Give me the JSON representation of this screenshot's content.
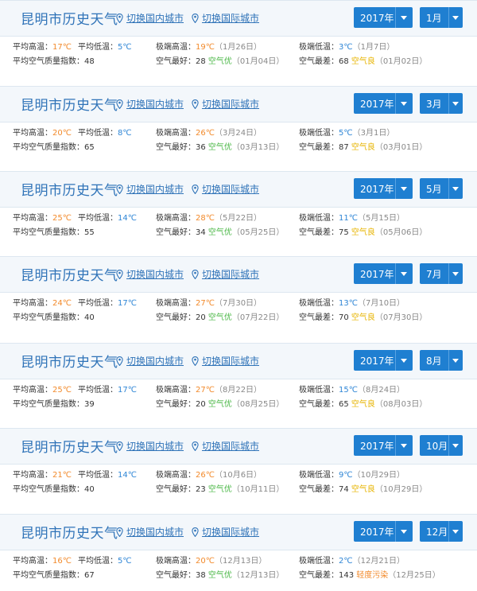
{
  "colors": {
    "accent": "#2f73b8",
    "dropdown": "#1f7fd1",
    "high_temp": "#f28a2b",
    "low_temp": "#2f86d6",
    "air_good": "#4cb848",
    "air_fair": "#e7b400",
    "air_polluted": "#f28a2b"
  },
  "icons": {
    "location": "map-pin-icon",
    "dropdown": "caret-down-icon"
  },
  "common": {
    "city_title": "昆明市历史天气",
    "link_domestic": "切换国内城市",
    "link_international": "切换国际城市",
    "label_avg_high": "平均高温：",
    "label_avg_low": "平均低温：",
    "label_ext_high": "极端高温：",
    "label_ext_low": "极端低温：",
    "label_avg_aqi": "平均空气质量指数：",
    "label_air_best": "空气最好：",
    "label_air_worst": "空气最差："
  },
  "panels": [
    {
      "year": "2017年",
      "month": "1月",
      "avg_high": "17℃",
      "avg_low": "5℃",
      "ext_high": "19℃",
      "ext_high_date": "（1月26日）",
      "ext_low": "3℃",
      "ext_low_date": "（1月7日）",
      "avg_aqi": "48",
      "best_value": "28",
      "best_level": "空气优",
      "best_date": "（01月04日）",
      "worst_value": "68",
      "worst_level": "空气良",
      "worst_date": "（01月02日）"
    },
    {
      "year": "2017年",
      "month": "3月",
      "avg_high": "20℃",
      "avg_low": "8℃",
      "ext_high": "26℃",
      "ext_high_date": "（3月24日）",
      "ext_low": "5℃",
      "ext_low_date": "（3月1日）",
      "avg_aqi": "65",
      "best_value": "36",
      "best_level": "空气优",
      "best_date": "（03月13日）",
      "worst_value": "87",
      "worst_level": "空气良",
      "worst_date": "（03月01日）"
    },
    {
      "year": "2017年",
      "month": "5月",
      "avg_high": "25℃",
      "avg_low": "14℃",
      "ext_high": "28℃",
      "ext_high_date": "（5月22日）",
      "ext_low": "11℃",
      "ext_low_date": "（5月15日）",
      "avg_aqi": "55",
      "best_value": "34",
      "best_level": "空气优",
      "best_date": "（05月25日）",
      "worst_value": "75",
      "worst_level": "空气良",
      "worst_date": "（05月06日）"
    },
    {
      "year": "2017年",
      "month": "7月",
      "avg_high": "24℃",
      "avg_low": "17℃",
      "ext_high": "27℃",
      "ext_high_date": "（7月30日）",
      "ext_low": "13℃",
      "ext_low_date": "（7月10日）",
      "avg_aqi": "40",
      "best_value": "20",
      "best_level": "空气优",
      "best_date": "（07月22日）",
      "worst_value": "70",
      "worst_level": "空气良",
      "worst_date": "（07月30日）"
    },
    {
      "year": "2017年",
      "month": "8月",
      "avg_high": "25℃",
      "avg_low": "17℃",
      "ext_high": "27℃",
      "ext_high_date": "（8月22日）",
      "ext_low": "15℃",
      "ext_low_date": "（8月24日）",
      "avg_aqi": "39",
      "best_value": "20",
      "best_level": "空气优",
      "best_date": "（08月25日）",
      "worst_value": "65",
      "worst_level": "空气良",
      "worst_date": "（08月03日）"
    },
    {
      "year": "2017年",
      "month": "10月",
      "avg_high": "21℃",
      "avg_low": "14℃",
      "ext_high": "26℃",
      "ext_high_date": "（10月6日）",
      "ext_low": "9℃",
      "ext_low_date": "（10月29日）",
      "avg_aqi": "40",
      "best_value": "23",
      "best_level": "空气优",
      "best_date": "（10月11日）",
      "worst_value": "74",
      "worst_level": "空气良",
      "worst_date": "（10月29日）"
    },
    {
      "year": "2017年",
      "month": "12月",
      "avg_high": "16℃",
      "avg_low": "5℃",
      "ext_high": "20℃",
      "ext_high_date": "（12月13日）",
      "ext_low": "2℃",
      "ext_low_date": "（12月21日）",
      "avg_aqi": "67",
      "best_value": "38",
      "best_level": "空气优",
      "best_date": "（12月13日）",
      "worst_value": "143",
      "worst_level": "轻度污染",
      "worst_date": "（12月25日）"
    }
  ]
}
